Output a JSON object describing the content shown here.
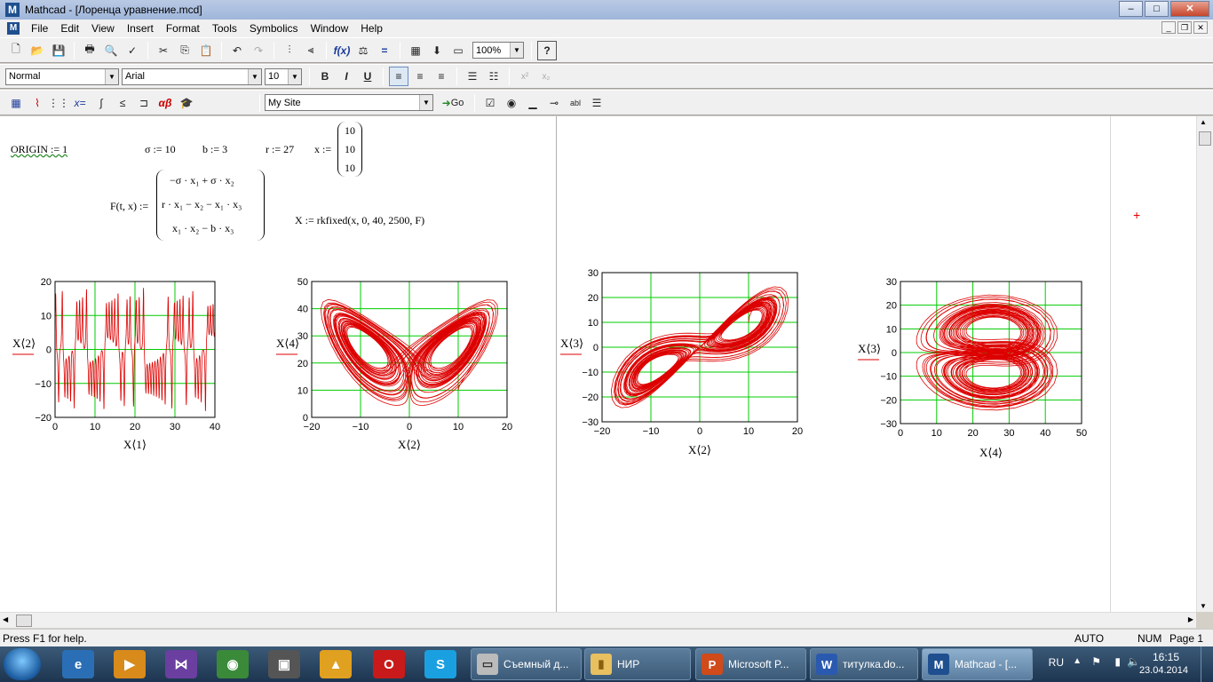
{
  "window": {
    "title": "Mathcad - [Лоренца уравнение.mcd]",
    "minimize": "–",
    "maximize": "□",
    "close": "✕"
  },
  "menu": {
    "items": [
      "File",
      "Edit",
      "View",
      "Insert",
      "Format",
      "Tools",
      "Symbolics",
      "Window",
      "Help"
    ]
  },
  "toolbar": {
    "zoom": "100%",
    "style": "Normal",
    "font": "Arial",
    "size": "10",
    "bold": "B",
    "italic": "I",
    "underline": "U",
    "site": "My Site",
    "go": "Go"
  },
  "worksheet": {
    "origin": "ORIGIN := 1",
    "sigma": "σ := 10",
    "b": "b := 3",
    "r": "r := 27",
    "x_def": "x :=",
    "x_vector": [
      "10",
      "10",
      "10"
    ],
    "F_def": "F(t, x) :=",
    "F_rows": [
      "−σ · x₁ + σ · x₂",
      "r · x₁ − x₂ − x₁ · x₃",
      "x₁ · x₂ − b · x₃"
    ],
    "X_def": "X := rkfixed(x, 0, 40, 2500, F)"
  },
  "chart_data": [
    {
      "type": "line",
      "xlabel": "X⟨1⟩",
      "ylabel": "X⟨2⟩",
      "xlim": [
        0,
        40
      ],
      "ylim": [
        -20,
        20
      ],
      "xticks": [
        "0",
        "10",
        "20",
        "30",
        "40"
      ],
      "yticks": [
        "20",
        "10",
        "0",
        "−10",
        "−20"
      ],
      "grid": true,
      "color": "#dd0000"
    },
    {
      "type": "line",
      "xlabel": "X⟨2⟩",
      "ylabel": "X⟨4⟩",
      "xlim": [
        -20,
        20
      ],
      "ylim": [
        0,
        50
      ],
      "xticks": [
        "−20",
        "−10",
        "0",
        "10",
        "20"
      ],
      "yticks": [
        "50",
        "40",
        "30",
        "20",
        "10",
        "0"
      ],
      "grid": true,
      "color": "#dd0000"
    },
    {
      "type": "line",
      "xlabel": "X⟨2⟩",
      "ylabel": "X⟨3⟩",
      "xlim": [
        -20,
        20
      ],
      "ylim": [
        -30,
        30
      ],
      "xticks": [
        "−20",
        "−10",
        "0",
        "10",
        "20"
      ],
      "yticks": [
        "30",
        "20",
        "10",
        "0",
        "−10",
        "−20",
        "−30"
      ],
      "grid": true,
      "color": "#dd0000"
    },
    {
      "type": "line",
      "xlabel": "X⟨4⟩",
      "ylabel": "X⟨3⟩",
      "xlim": [
        0,
        50
      ],
      "ylim": [
        -30,
        30
      ],
      "xticks": [
        "0",
        "10",
        "20",
        "30",
        "40",
        "50"
      ],
      "yticks": [
        "30",
        "20",
        "10",
        "0",
        "−10",
        "−20",
        "−30"
      ],
      "grid": true,
      "color": "#dd0000"
    }
  ],
  "status": {
    "help": "Press F1 for help.",
    "auto": "AUTO",
    "num": "NUM",
    "page": "Page 1"
  },
  "taskbar": {
    "tasks": [
      "Съемный д...",
      "НИР",
      "Microsoft P...",
      "титулка.do...",
      "Mathcad - [..."
    ],
    "lang": "RU",
    "time": "16:15",
    "date": "23.04.2014"
  },
  "colors": {
    "plot_line": "#dd0000",
    "grid": "#00cc00"
  }
}
